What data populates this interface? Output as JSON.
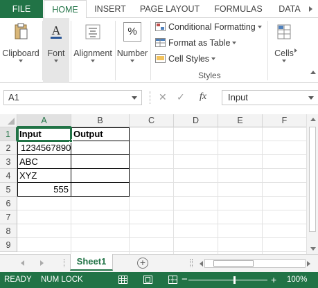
{
  "ribbon_tabs": {
    "file": "FILE",
    "home": "HOME",
    "insert": "INSERT",
    "page_layout": "PAGE LAYOUT",
    "formulas": "FORMULAS",
    "data": "DATA"
  },
  "ribbon": {
    "clipboard": "Clipboard",
    "font": "Font",
    "alignment": "Alignment",
    "number": "Number",
    "number_icon": "%",
    "conditional_formatting": "Conditional Formatting",
    "format_as_table": "Format as Table",
    "cell_styles": "Cell Styles",
    "styles_group": "Styles",
    "cells": "Cells"
  },
  "formula_bar": {
    "name_box": "A1",
    "cancel_icon": "✕",
    "enter_icon": "✓",
    "fx_label": "fx",
    "content": "Input"
  },
  "columns": [
    "A",
    "B",
    "C",
    "D",
    "E",
    "F"
  ],
  "rows": [
    "1",
    "2",
    "3",
    "4",
    "5",
    "6",
    "7",
    "8",
    "9"
  ],
  "cells": {
    "A1": "Input",
    "B1": "Output",
    "A2": "1234567890",
    "A3": "ABC",
    "A4": "XYZ",
    "A5": "555"
  },
  "sheet_tabs": {
    "active": "Sheet1",
    "add_icon": "+"
  },
  "status_bar": {
    "ready": "READY",
    "num_lock": "NUM LOCK",
    "zoom_minus": "−",
    "zoom_plus": "+",
    "zoom": "100%",
    "zoom_level": 100
  },
  "colors": {
    "accent": "#217346",
    "header_bg": "#f3f3f3",
    "grid_line": "#e1e1e1"
  }
}
